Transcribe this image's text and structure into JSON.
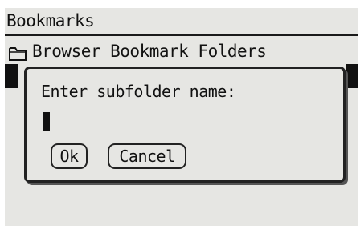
{
  "header": {
    "title": "Bookmarks"
  },
  "list": {
    "items": [
      {
        "label": "Browser Bookmark Folders",
        "icon": "folder-icon"
      }
    ]
  },
  "dialog": {
    "prompt": "Enter subfolder name:",
    "input_value": "",
    "ok_label": "Ok",
    "cancel_label": "Cancel"
  },
  "colors": {
    "screen_bg": "#e6e6e3",
    "text": "#111111",
    "border": "#222222"
  }
}
